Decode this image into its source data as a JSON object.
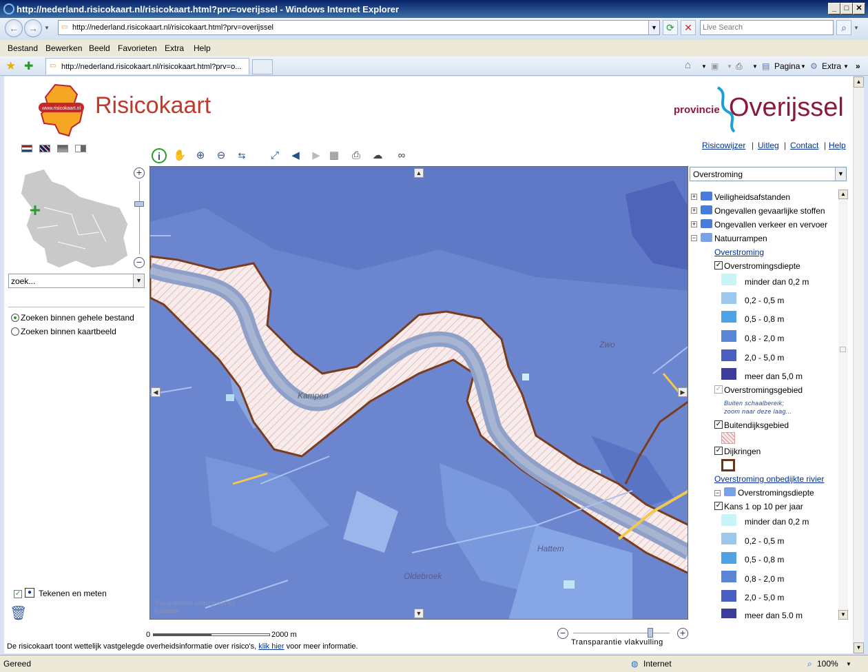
{
  "window": {
    "title": "http://nederland.risicokaart.nl/risicokaart.html?prv=overijssel - Windows Internet Explorer",
    "url": "http://nederland.risicokaart.nl/risicokaart.html?prv=overijssel",
    "search_placeholder": "Live Search",
    "tab_title": "http://nederland.risicokaart.nl/risicokaart.html?prv=o...",
    "menu": [
      "Bestand",
      "Bewerken",
      "Beeld",
      "Favorieten",
      "Extra",
      "Help"
    ],
    "cmd_pagina": "Pagina",
    "cmd_extra": "Extra"
  },
  "status": {
    "text": "Gereed",
    "zone": "Internet",
    "zoom": "100%"
  },
  "header": {
    "logo_badge": "www.risicokaart.nl",
    "title": "Risicokaart",
    "province_prefix": "provincie",
    "province_name": "Overijssel"
  },
  "links": [
    "Risicowijzer",
    "Uitleg",
    "Contact",
    "Help"
  ],
  "left": {
    "search_value": "zoek...",
    "radio_all": "Zoeken binnen gehele bestand",
    "radio_view": "Zoeken binnen kaartbeeld",
    "draw_label": "Tekenen en meten"
  },
  "map": {
    "labels": {
      "kampen": "Kampen",
      "hattem": "Hattem",
      "oldebroek": "Oldebroek",
      "zwolle": "Zwo"
    },
    "attribution": "Topografische ondergrond (c)\nKadaster",
    "scale_start": "0",
    "scale_end": "2000 m",
    "transparency_label": "Transparantie vlakvulling"
  },
  "legend": {
    "select_value": "Overstroming",
    "groups": [
      "Veiligheidsafstanden",
      "Ongevallen gevaarlijke stoffen",
      "Ongevallen verkeer en vervoer",
      "Natuurrampen"
    ],
    "sub_link_1": "Overstroming",
    "layer_depth": "Overstromingsdiepte",
    "classes": [
      {
        "label": "minder dan 0,2 m",
        "color": "#c8f4f8"
      },
      {
        "label": "0,2 - 0,5 m",
        "color": "#9cc8ee"
      },
      {
        "label": "0,5 - 0,8 m",
        "color": "#4ea3e6"
      },
      {
        "label": "0,8 - 2,0 m",
        "color": "#5a86d8"
      },
      {
        "label": "2,0 - 5,0 m",
        "color": "#4a5fc2"
      },
      {
        "label": "meer dan 5,0 m",
        "color": "#3c3c9a"
      }
    ],
    "layer_area": "Overstromingsgebied",
    "out_of_scale": "Buiten schaalbereik;\nzoom naar deze laag...",
    "layer_outside": "Buitendijksgebied",
    "layer_dikes": "Dijkringen",
    "sub_link_2": "Overstroming onbedijkte rivier",
    "layer_depth2": "Overstromingsdiepte",
    "layer_chance": "Kans 1 op 10 per jaar"
  },
  "footer": {
    "text_before": "De risicokaart toont wettelijk vastgelegde overheidsinformatie over risico's,",
    "link": "klik hier",
    "text_after": "voor meer informatie."
  }
}
